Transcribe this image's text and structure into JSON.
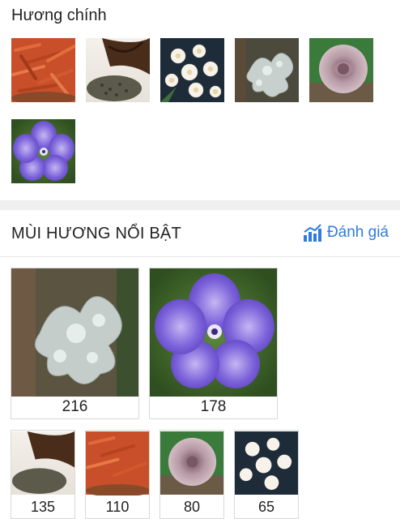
{
  "main_scents": {
    "title": "Hương chính",
    "items": [
      {
        "icon": "sandalwood-chips-icon"
      },
      {
        "icon": "tea-leaves-icon"
      },
      {
        "icon": "white-jasmine-flowers-icon"
      },
      {
        "icon": "oakmoss-lichen-icon"
      },
      {
        "icon": "rose-icon"
      },
      {
        "icon": "purple-geranium-icon"
      }
    ]
  },
  "featured": {
    "title": "MÙI HƯƠNG NỔI BẬT",
    "rate_label": "Đánh giá",
    "accent_color": "#2f7be0",
    "large": [
      {
        "icon": "oakmoss-lichen-icon",
        "count": "216"
      },
      {
        "icon": "purple-geranium-icon",
        "count": "178"
      }
    ],
    "small": [
      {
        "icon": "tea-leaves-icon",
        "count": "135"
      },
      {
        "icon": "sandalwood-chips-icon",
        "count": "110"
      },
      {
        "icon": "rose-icon",
        "count": "80"
      },
      {
        "icon": "white-jasmine-flowers-icon",
        "count": "65"
      }
    ]
  }
}
